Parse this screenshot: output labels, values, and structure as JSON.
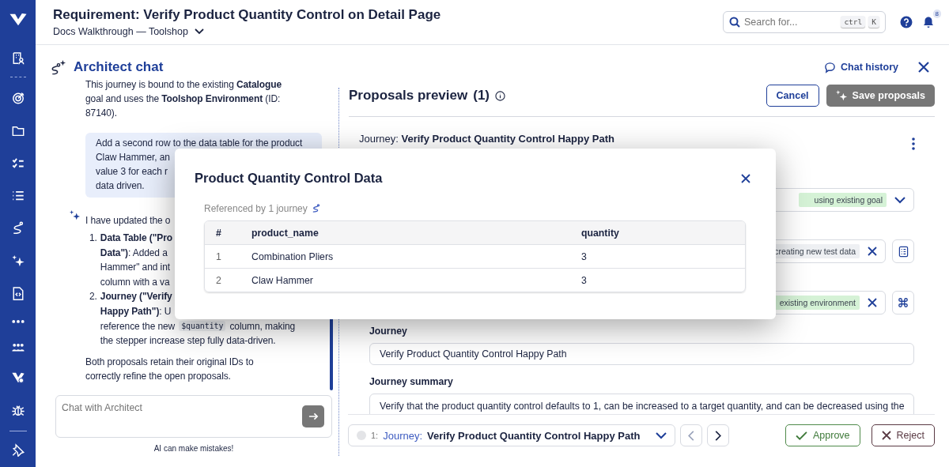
{
  "app": {
    "title": "Requirement: Verify Product Quantity Control on Detail Page",
    "project": "Docs Walkthrough — Toolshop"
  },
  "search": {
    "placeholder": "Search for...",
    "keys": [
      "ctrl",
      "K"
    ]
  },
  "notifications": {
    "count": "8"
  },
  "chat": {
    "title": "Architect chat",
    "history_link": "Chat history",
    "messages": [
      {
        "kind": "paragraph",
        "text": "This journey is bound to the existing **Catalogue** goal and uses the **Toolshop Environment** (ID: 87140)."
      },
      {
        "kind": "user",
        "lines": [
          "Add a second row to the data table for the product",
          "Claw Hammer, an",
          "value 3 for each r",
          "data driven."
        ]
      },
      {
        "kind": "assistant",
        "lines": [
          "I have updated the o"
        ],
        "items": [
          {
            "number": "1.",
            "lines": [
              [
                {
                  "kind": "text",
                  "text": "**Data Table (\"Pro**"
                }
              ],
              [
                {
                  "kind": "text",
                  "text": "**Data\")**: Added a"
                }
              ],
              [
                {
                  "kind": "text",
                  "text": "Hammer\" and int"
                }
              ],
              [
                {
                  "kind": "text",
                  "text": "column with a va"
                }
              ]
            ]
          },
          {
            "number": "2.",
            "lines": [
              [
                {
                  "kind": "text",
                  "text": "**Journey (\"Verify**"
                }
              ],
              [
                {
                  "kind": "text",
                  "text": "**Happy Path\")**: U"
                }
              ],
              [
                {
                  "kind": "text",
                  "text": "reference the new"
                },
                {
                  "kind": "code",
                  "text": "$quantity"
                },
                {
                  "kind": "text",
                  "text": "column, making"
                }
              ],
              [
                {
                  "kind": "text",
                  "text": "the stepper increase step fully data-driven."
                }
              ]
            ]
          }
        ]
      },
      {
        "kind": "paragraph",
        "text": "Both proposals retain their original IDs to correctly refine the open proposals."
      }
    ],
    "input": {
      "placeholder": "Chat with Architect"
    },
    "disclaimer": "AI can make mistakes!"
  },
  "proposals": {
    "title": "Proposals preview",
    "count": "(1)",
    "cancel": "Cancel",
    "save": {
      "label": "Save proposals",
      "disabled": true
    },
    "card": {
      "prefix": "Journey:",
      "name": "Verify Product Quantity Control Happy Path",
      "rows": [
        {
          "kind": "select",
          "chip": "using existing goal",
          "color": "#d5f2d6"
        },
        {
          "kind": "removable",
          "chip": "creating new test data",
          "color": "#eef0f3",
          "side": {
            "kind": "table"
          }
        },
        {
          "kind": "removable",
          "chip": "existing environment",
          "color": "#d5f2d6",
          "side": {
            "kind": "command"
          }
        }
      ],
      "journey_label": "Journey",
      "journey_value": "Verify Product Quantity Control Happy Path",
      "summary_label": "Journey summary",
      "summary_value": "Verify that the product quantity control defaults to 1, can be increased to a target quantity, and can be decreased using the"
    },
    "footer": {
      "done": false,
      "index": "1:",
      "type": "Journey:",
      "name": "Verify Product Quantity Control Happy Path",
      "prev_disabled": true,
      "next_disabled": false,
      "approve": "Approve",
      "reject": "Reject"
    }
  },
  "modal": {
    "title": "Product Quantity Control Data",
    "referenced": "Referenced by 1 journey",
    "columns": [
      "#",
      "product_name",
      "quantity"
    ],
    "rows": [
      [
        "1",
        "Combination Pliers",
        "3"
      ],
      [
        "2",
        "Claw Hammer",
        "3"
      ]
    ]
  }
}
